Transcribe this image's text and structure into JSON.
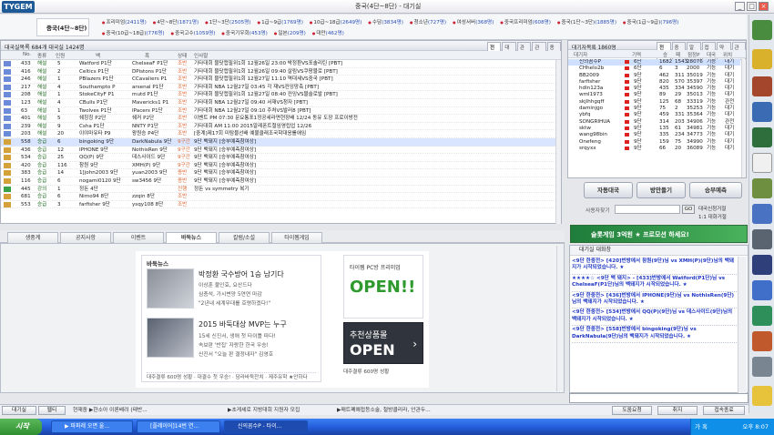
{
  "app": {
    "logo": "TYGEM",
    "window_title": "중국(4단~8단) - 대기실",
    "win_buttons": [
      "_",
      "□",
      "×"
    ]
  },
  "room": {
    "name": "중국(4단~8단)",
    "cells": [
      {
        "label": "프리미엄",
        "count": "(2411명)"
      },
      {
        "label": "4단~8단",
        "count": "(1871명)"
      },
      {
        "label": "1단~3단",
        "count": "(2505명)"
      },
      {
        "label": "1급~9급",
        "count": "(1769명)"
      },
      {
        "label": "10급~18급",
        "count": "(2649명)"
      },
      {
        "label": "수담",
        "count": "(3834명)"
      },
      {
        "label": "청소년",
        "count": "(727명)"
      },
      {
        "label": "여성서버",
        "count": "(368명)"
      },
      {
        "label": "중국프리미엄",
        "count": "(608명)"
      },
      {
        "label": "중국(1단~3단)",
        "count": "(1885명)"
      },
      {
        "label": "중국(1급~9급)",
        "count": "(796명)"
      },
      {
        "label": "중국(10급~18급)",
        "count": "(776명)"
      },
      {
        "label": "중국고수",
        "count": "(1059명)"
      },
      {
        "label": "중국기우회",
        "count": "(453명)"
      },
      {
        "label": "일본",
        "count": "(209명)"
      },
      {
        "label": "대만",
        "count": "(462명)"
      }
    ]
  },
  "games": {
    "header": "대국실목록  684개 대국실  1424명",
    "tabs": [
      "전체",
      "대국",
      "관전",
      "관전",
      "종료"
    ],
    "columns": [
      "No.",
      "종류",
      "인원",
      "백",
      "흑",
      "상태",
      "인사말"
    ],
    "rows": [
      {
        "no": "433",
        "type": "해설",
        "n": "5",
        "w": "Watford P1단",
        "b": "ChelseaF P1단",
        "s": "조반",
        "m": "기타대회 블닷캡필위1회 12월26일 23:00 박정환VS포솔리틴 [PBT]"
      },
      {
        "no": "416",
        "type": "해설",
        "n": "2",
        "w": "Celtics P1단",
        "b": "DPistons P1단",
        "s": "조반",
        "m": "기타대회 블닷캡필위1회 12월26일 09:40 살림VS쿠팡블로 [PBT]"
      },
      {
        "no": "246",
        "type": "해설",
        "n": "1",
        "w": "PBlazers P1단",
        "b": "CCavaliers P1",
        "s": "조반",
        "m": "기타대회 블닷캡필위1회 12월27일 11:10 역대세VS중국 [PBT]"
      },
      {
        "no": "217",
        "type": "해설",
        "n": "4",
        "w": "Southampto P",
        "b": "arsenal P1단",
        "s": "조반",
        "m": "기타대회 NBA 12월27일 03:45 각 재VS컨잉망축 [PBT]"
      },
      {
        "no": "208",
        "type": "해설",
        "n": "1",
        "w": "StokeCityF P1",
        "b": "mutd P1단",
        "s": "조반",
        "m": "기타대회 블닷캡필위1회 12월27일 08:40 컨잉VS블슬로발 [PBT]"
      },
      {
        "no": "123",
        "type": "해설",
        "n": "4",
        "w": "CBulls P1단",
        "b": "Mavericks1 P1",
        "s": "조반",
        "m": "기타대회 NBA 12월27일 09:40 서재VS청자 [PBT]"
      },
      {
        "no": "63",
        "type": "해설",
        "n": "1",
        "w": "Twolves P1단",
        "b": "IPacers P1단",
        "s": "조반",
        "m": "기타대회 NBA 12월27일 09:10 주처VS발러8 [PBT]"
      },
      {
        "no": "401",
        "type": "해설",
        "n": "5",
        "w": "쉐칭칭 P2단",
        "b": "쉐커 P2단",
        "s": "조반",
        "m": "이벤트 PM 07:30 문요통포1정공세라면현장배 12/24 동유 도장 프로이방전"
      },
      {
        "no": "239",
        "type": "해설",
        "n": "9",
        "w": "Csha P1단",
        "b": "NNTY P1단",
        "s": "조반",
        "m": "기타대회 AM 11:00 2015알레폰트절임영립업 12/26"
      },
      {
        "no": "203",
        "type": "해설",
        "n": "20",
        "w": "이야마유타 P9",
        "b": "왕원승 P4단",
        "s": "조반",
        "m": "[중계]제17회 미탐블선배 예불클래조국학대응롤애임"
      },
      {
        "no": "558",
        "type": "승급",
        "n": "6",
        "w": "bingoking 9단",
        "b": "DarkNabula 9단",
        "s": "9구간",
        "m": "9단 백돼지 [승부예측참여상]"
      },
      {
        "no": "436",
        "type": "승급",
        "n": "12",
        "w": "IPHONE 9단",
        "b": "NothisRen 9단",
        "s": "9구간",
        "m": "9단 백돼지 [승부예측참여상]"
      },
      {
        "no": "534",
        "type": "승급",
        "n": "25",
        "w": "QQ(P) 9단",
        "b": "데스사이드 9단",
        "s": "9구간",
        "m": "9단 백돼지 [승부예측참여상]"
      },
      {
        "no": "420",
        "type": "승급",
        "n": "116",
        "w": "참원 9단",
        "b": "XMH(P) 9단",
        "s": "9구간",
        "m": "9단 백돼지 [승부예측참여상]"
      },
      {
        "no": "383",
        "type": "승급",
        "n": "14",
        "w": "1[john2003 9단",
        "b": "yuan2003 9단",
        "s": "종반",
        "m": "9단 백돼지 [승부예측참여상]"
      },
      {
        "no": "116",
        "type": "승급",
        "n": "6",
        "w": "nogami0120 9단",
        "b": "sw3456 9단",
        "s": "종반",
        "m": "9단 백돼지 [승부예측참여상]"
      },
      {
        "no": "445",
        "type": "강의",
        "n": "1",
        "w": "정돈 4단",
        "b": "",
        "s": "진행",
        "m": "정돈 vs symmetry 복기"
      },
      {
        "no": "681",
        "type": "승급",
        "n": "6",
        "w": "Nimo94 8단",
        "b": "zzqin 8단",
        "s": "조반",
        "m": ""
      },
      {
        "no": "553",
        "type": "승급",
        "n": "3",
        "w": "farfisher 9단",
        "b": "ysqy108 8단",
        "s": "조반",
        "m": ""
      }
    ]
  },
  "users": {
    "header": "대기자목록  1860명",
    "tabs": [
      "전체",
      "중국",
      "알수",
      "접속",
      "약칭",
      "관전"
    ],
    "columns": [
      "대기자",
      "기력",
      "승",
      "패",
      "점정P",
      "대국",
      "위치"
    ],
    "rows": [
      {
        "name": "신의꼼수P",
        "lv": "6단",
        "w": "1682",
        "l": "1543",
        "p": "28076",
        "g": "기능",
        "loc": "대기"
      },
      {
        "name": "CHhelo2b",
        "lv": "6단",
        "w": "6",
        "l": "3",
        "p": "2000",
        "g": "기능",
        "loc": "대기"
      },
      {
        "name": "BB2009",
        "lv": "9단",
        "w": "462",
        "l": "311",
        "p": "35019",
        "g": "기능",
        "loc": "대기"
      },
      {
        "name": "farfisher",
        "lv": "9단",
        "w": "820",
        "l": "570",
        "p": "35397",
        "g": "기능",
        "loc": "대기"
      },
      {
        "name": "hdln123a",
        "lv": "9단",
        "w": "435",
        "l": "334",
        "p": "34590",
        "g": "기능",
        "loc": "대기"
      },
      {
        "name": "wml1973",
        "lv": "9단",
        "w": "89",
        "l": "29",
        "p": "35013",
        "g": "기능",
        "loc": "대기"
      },
      {
        "name": "skjlhhgqff",
        "lv": "9단",
        "w": "125",
        "l": "68",
        "p": "33319",
        "g": "기능",
        "loc": "관전"
      },
      {
        "name": "daminjgo",
        "lv": "9단",
        "w": "75",
        "l": "2",
        "p": "35253",
        "g": "기능",
        "loc": "대기"
      },
      {
        "name": "ybfq",
        "lv": "9단",
        "w": "459",
        "l": "331",
        "p": "35364",
        "g": "기능",
        "loc": "대기"
      },
      {
        "name": "SONGRIHUA",
        "lv": "9단",
        "w": "314",
        "l": "203",
        "p": "34906",
        "g": "기능",
        "loc": "관전"
      },
      {
        "name": "sktw",
        "lv": "9단",
        "w": "135",
        "l": "61",
        "p": "34981",
        "g": "기능",
        "loc": "대기"
      },
      {
        "name": "wang98bin",
        "lv": "9단",
        "w": "335",
        "l": "234",
        "p": "34773",
        "g": "기능",
        "loc": "대기"
      },
      {
        "name": "Onefeng",
        "lv": "9단",
        "w": "159",
        "l": "75",
        "p": "34990",
        "g": "기능",
        "loc": "대기"
      },
      {
        "name": "srqyxx",
        "lv": "9단",
        "w": "66",
        "l": "20",
        "p": "36089",
        "g": "기능",
        "loc": "대기"
      }
    ]
  },
  "actions": {
    "auto": "자동대국",
    "create": "방만들기",
    "predict": "승부예측",
    "search_label": "사용자찾기",
    "go": "GO",
    "opt1": "대국신청거절",
    "opt2": "1:1 대화거절"
  },
  "banner": {
    "text": "슬롯게임 3억원 ★ 프로모션 하세요!"
  },
  "chat": {
    "header": "대기실 대화창",
    "messages": [
      "<9단 한중전> [420]번방에서 참원(9단)님 vs XMH(P)(9단)님의 백돼지가 시작되었습니다. ★",
      "★★★★☆ <9단 백 돼지> - [433]번방에서 Watford(P1단)님 vs ChelseaF(P1단)님의 백돼지가 시작되었습니다. ★",
      "<9단 한중전> [436]번방에서 IPHONE(9단)님 vs NothisRen(9단)님의 백돼지가 시작되었습니다. ★",
      "<9단 한중전> [534]번방에서 QQ(P)(9단)님 vs 데스사이드(9단)님의 백돼지가 시작되었습니다. ★",
      "<9단 한중전> [558]번방에서 bingoking(9단)님 vs DarkNabula(9단)님의 백돼지가 시작되었습니다. ★"
    ]
  },
  "bottom_tabs": [
    "생중계",
    "공지사항",
    "이벤트",
    "바둑뉴스",
    "칼럼/소설",
    "타이젬게임"
  ],
  "news": {
    "title": "바둑뉴스",
    "items": [
      {
        "head": "박정환 국수방어 1승 남기다",
        "lines": [
          "이상훈 불인효, 요산드다",
          "심층석, 가시변양 5연연 마감",
          "\"2년내 세계무대를 호령하겠다!\""
        ]
      },
      {
        "head": "2015 바둑대상 MVP는 누구",
        "lines": [
          "15세 신진서, 생애 첫 타이틀 따다!",
          "속보판 '반집' 자랑한 한국 우승!",
          "신진서 \"오늘 판 결정내자\" 김영호"
        ]
      }
    ],
    "foot": "대주결류 600명 성황 · 대결수 첫 우승! · 담라바둑잔치 · 제주유학 ★안하다",
    "ad1_small": "타이젬 PC방 프리미엄",
    "ad1_big": "OPEN!!",
    "ad2_small": "추천상품몰",
    "ad2_big": "OPEN",
    "ad_foot": "대주결류 600명 성황"
  },
  "status": {
    "tab1": "대기실",
    "tab2": "웹티",
    "items": [
      "현재중 ▶한소아 이론배려 (태반...",
      "▶초게셰로 지방대회 지원자 모집",
      "▶매트폐예접등소술, 철방클리라, 안관두..."
    ],
    "btn_help": "도움요청",
    "btn_close": "취지",
    "btn_exit": "접속종료"
  },
  "taskbar": {
    "start": "시작",
    "tasks": [
      "▶ 파파레 오면 울...",
      "[플레이어]14번 연...",
      "신의꼼수P - 타이..."
    ],
    "tray": "오후 8:07",
    "ime": "가 혹"
  }
}
